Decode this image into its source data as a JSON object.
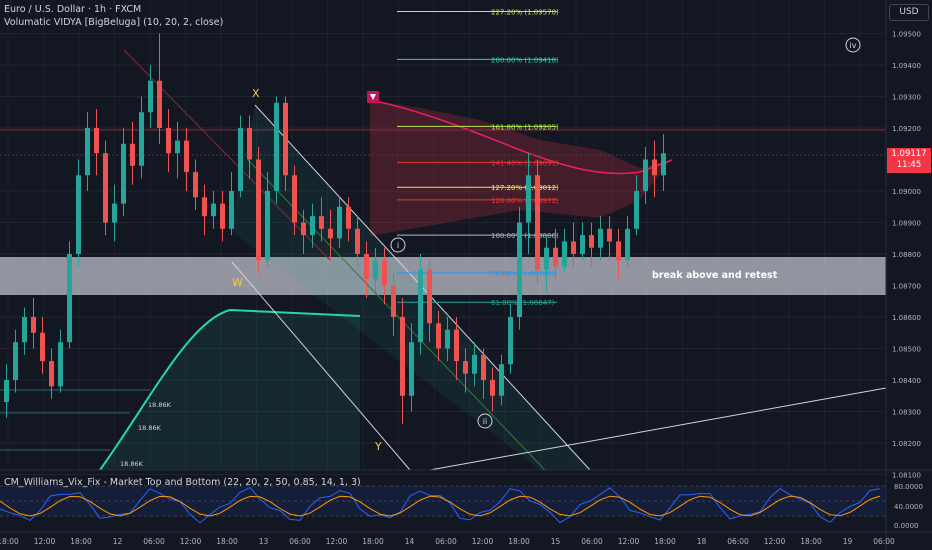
{
  "chart_header": {
    "symbol": "Euro / U.S. Dollar · 1h · FXCM",
    "indicator": "Volumatic VIDYA [BigBeluga] (10, 20, 2, close)",
    "lower_indicator": "CM_Williams_Vix_Fix - Market Top and Bottom (22, 20, 2, 50, 0.85, 14, 1, 3)"
  },
  "currency": "USD",
  "last_price": {
    "value": "1.09117",
    "countdown": "11:45"
  },
  "zone_label": "break above and retest",
  "wave_labels": {
    "x": "X",
    "w": "W",
    "y": "Y",
    "iv": "iv",
    "i": "i",
    "ii": "ii"
  },
  "fib_levels": [
    {
      "label": "227.20% (1.09570)",
      "price": 1.0957,
      "color": "#d4e157"
    },
    {
      "label": "200.00% (1.09418)",
      "price": 1.09418,
      "color": "#26d7a6"
    },
    {
      "label": "161.80% (1.09205)",
      "price": 1.09205,
      "color": "#b5e853"
    },
    {
      "label": "141.40% (1.09091)",
      "price": 1.09091,
      "color": "#e53935"
    },
    {
      "label": "127.20% (1.09012)",
      "price": 1.09012,
      "color": "#e6e65a"
    },
    {
      "label": "120.00% (1.08972)",
      "price": 1.08972,
      "color": "#e53935"
    },
    {
      "label": "100.00% (1.08860)",
      "price": 1.0886,
      "color": "#b2b5be"
    },
    {
      "label": "78.60% (1.08740)",
      "price": 1.0874,
      "color": "#2196f3"
    },
    {
      "label": "61.80% (1.08647)",
      "price": 1.08647,
      "color": "#26a69a"
    }
  ],
  "price_axis": [
    "1.09500",
    "1.09400",
    "1.09300",
    "1.09200",
    "1.09000",
    "1.08900",
    "1.08800",
    "1.08700",
    "1.08600",
    "1.08500",
    "1.08400",
    "1.08300",
    "1.08200",
    "1.08100"
  ],
  "osc_axis": [
    "80.0000",
    "40.0000",
    "0.0000"
  ],
  "time_axis": [
    "18:00",
    "12:00",
    "18:00",
    "12",
    "06:00",
    "12:00",
    "18:00",
    "13",
    "06:00",
    "12:00",
    "18:00",
    "14",
    "06:00",
    "12:00",
    "18:00",
    "15",
    "06:00",
    "12:00",
    "18:00",
    "18",
    "06:00",
    "12:00",
    "18:00",
    "19",
    "06:00"
  ],
  "volume_labels": [
    "18.86K",
    "18.86K",
    "18.86K"
  ],
  "colors": {
    "bg": "#131722",
    "up": "#26a69a",
    "down": "#ef5350",
    "text": "#d1d4dc",
    "zone": "#e0e3eb",
    "accent": "#f23645"
  },
  "icons": {
    "bearish_marker": "triangle-down-icon"
  }
}
